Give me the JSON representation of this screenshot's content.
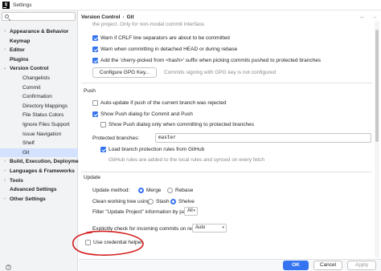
{
  "window": {
    "title": "Settings",
    "app_icon": "IJ"
  },
  "sidebar": {
    "search_placeholder": "",
    "items": [
      {
        "label": "Appearance & Behavior",
        "bold": true,
        "chev": "›",
        "indent": 0
      },
      {
        "label": "Keymap",
        "bold": true,
        "chev": "",
        "indent": 0
      },
      {
        "label": "Editor",
        "bold": true,
        "chev": "›",
        "indent": 0
      },
      {
        "label": "Plugins",
        "bold": true,
        "chev": "",
        "indent": 0
      },
      {
        "label": "Version Control",
        "bold": true,
        "chev": "⌄",
        "indent": 0
      },
      {
        "label": "Changelists",
        "bold": false,
        "chev": "",
        "indent": 1
      },
      {
        "label": "Commit",
        "bold": false,
        "chev": "",
        "indent": 1
      },
      {
        "label": "Confirmation",
        "bold": false,
        "chev": "",
        "indent": 1
      },
      {
        "label": "Directory Mappings",
        "bold": false,
        "chev": "",
        "indent": 1
      },
      {
        "label": "File Status Colors",
        "bold": false,
        "chev": "",
        "indent": 1
      },
      {
        "label": "Ignore Files Support",
        "bold": false,
        "chev": "",
        "indent": 1
      },
      {
        "label": "Issue Navigation",
        "bold": false,
        "chev": "",
        "indent": 1
      },
      {
        "label": "Shelf",
        "bold": false,
        "chev": "",
        "indent": 1
      },
      {
        "label": "Git",
        "bold": false,
        "chev": "",
        "indent": 1,
        "selected": true
      },
      {
        "label": "Build, Execution, Deployment",
        "bold": true,
        "chev": "›",
        "indent": 0
      },
      {
        "label": "Languages & Frameworks",
        "bold": true,
        "chev": "›",
        "indent": 0
      },
      {
        "label": "Tools",
        "bold": true,
        "chev": "›",
        "indent": 0
      },
      {
        "label": "Advanced Settings",
        "bold": true,
        "chev": "",
        "indent": 0
      },
      {
        "label": "Other Settings",
        "bold": true,
        "chev": "›",
        "indent": 0
      }
    ]
  },
  "breadcrumb": {
    "part1": "Version Control",
    "sep": "›",
    "part2": "Git"
  },
  "content": {
    "intro_note": "the project. Only for non-modal commit interface.",
    "warn_crlf": "Warn if CRLF line separators are about to be committed",
    "warn_detached": "Warn when committing in detached HEAD or during rebase",
    "cherry_pick": "Add the 'cherry-picked from <hash>' suffix when picking commits pushed to protected branches",
    "configure_gpg": "Configure GPG Key...",
    "gpg_note": "Commits signing with GPG key is not configured",
    "push_section": "Push",
    "auto_update": "Auto-update if push of the current branch was rejected",
    "show_push_dialog": "Show Push dialog for Commit and Push",
    "show_push_protected": "Show Push dialog only when committing to protected branches",
    "protected_branches_label": "Protected branches:",
    "protected_branches_value": "master",
    "load_branch_rules": "Load branch protection rules from GitHub",
    "github_rules_note": "GitHub rules are added to the local rules and synced on every fetch",
    "update_section": "Update",
    "update_method_label": "Update method:",
    "update_merge": "Merge",
    "update_rebase": "Rebase",
    "clean_tree_label": "Clean working tree using:",
    "clean_stash": "Stash",
    "clean_shelve": "Shelve",
    "filter_label": "Filter \"Update Project\" information by paths:",
    "filter_value": "All",
    "explicit_check_label": "Explicitly check for incoming commits on remotes:",
    "explicit_check_value": "Auto",
    "use_credential_helper": "Use credential helper"
  },
  "footer": {
    "ok": "OK",
    "cancel": "Cancel",
    "apply": "Apply",
    "help": "?"
  },
  "colors": {
    "accent": "#3574f0",
    "annotation": "#d42020",
    "selection": "#d4e2ff"
  },
  "icons": {
    "search": "search-icon",
    "back": "back-arrow-icon",
    "forward": "forward-arrow-icon",
    "combo": "chevron-down-icon"
  }
}
